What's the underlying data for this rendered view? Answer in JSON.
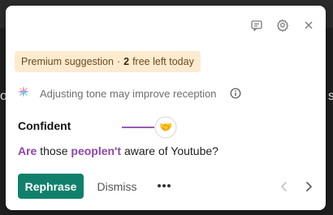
{
  "background": {
    "left_edge_char": "o",
    "right_edge_char": "s"
  },
  "header": {
    "icons": [
      "feedback-icon",
      "settings-icon",
      "close-icon"
    ]
  },
  "premium": {
    "label": "Premium suggestion",
    "separator": "·",
    "free_count": "2",
    "suffix": "free left today"
  },
  "tone": {
    "message": "Adjusting tone may improve reception",
    "icon": "sparkle-logo-icon",
    "info_icon": "info-icon"
  },
  "suggestion": {
    "tone_label": "Confident",
    "tone_emoji": "🤝",
    "sentence": {
      "part1": "Are",
      "part2": " those ",
      "part3": "peoplen't",
      "part4": " aware of Youtube?"
    }
  },
  "actions": {
    "rephrase_label": "Rephrase",
    "dismiss_label": "Dismiss",
    "more_label": "•••"
  },
  "colors": {
    "primary": "#10806c",
    "highlight": "#8e44ad",
    "premium_bg": "#fdebd0"
  }
}
